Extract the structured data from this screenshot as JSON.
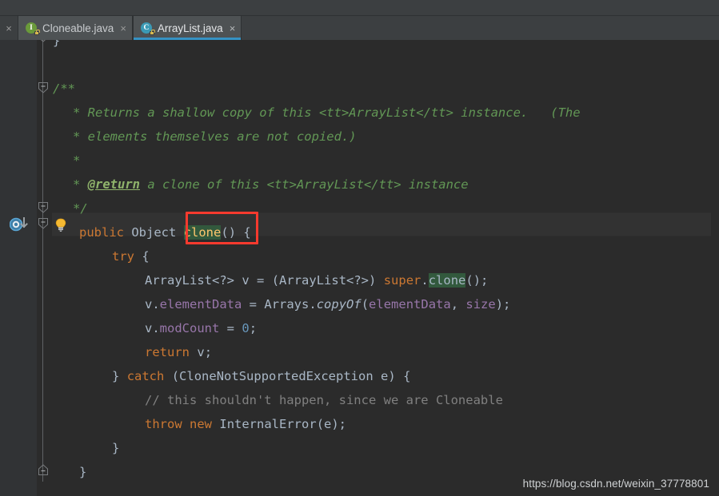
{
  "window": {
    "theme_background": "#2b2b2b",
    "chrome_background": "#3c3f41",
    "accent": "#3592c4"
  },
  "tabbar": {
    "close_all_glyph": "×",
    "tabs": [
      {
        "label": "Cloneable.java",
        "icon": "java-interface-icon",
        "icon_letter": "I",
        "active": false,
        "close_glyph": "×"
      },
      {
        "label": "ArrayList.java",
        "icon": "java-class-icon",
        "icon_letter": "C",
        "active": true,
        "close_glyph": "×"
      }
    ]
  },
  "gutter": {
    "implements_marker": "implementing-method-icon",
    "intention_bulb": "lightbulb-icon",
    "fold_markers": [
      "fold-collapse-icon",
      "fold-collapse-icon",
      "fold-collapse-icon",
      "fold-collapse-icon",
      "fold-collapse-icon"
    ]
  },
  "annotation": {
    "red_box_label": "red-highlight-rectangle",
    "color": "#f83a2e"
  },
  "watermark": {
    "text": "https://blog.csdn.net/weixin_37778801"
  },
  "editor": {
    "language": "Java",
    "current_line_text": "public Object clone() {",
    "caret_token": "clone",
    "code_lines": [
      {
        "n": 0,
        "text": "    }"
      },
      {
        "n": 1,
        "text": ""
      },
      {
        "n": 2,
        "text": "    /**"
      },
      {
        "n": 3,
        "text": "     * Returns a shallow copy of this <tt>ArrayList</tt> instance.   (The"
      },
      {
        "n": 4,
        "text": "     * elements themselves are not copied.)"
      },
      {
        "n": 5,
        "text": "     *"
      },
      {
        "n": 6,
        "text": "     * @return a clone of this <tt>ArrayList</tt> instance"
      },
      {
        "n": 7,
        "text": "     */"
      },
      {
        "n": 8,
        "text": "    public Object clone() {"
      },
      {
        "n": 9,
        "text": "        try {"
      },
      {
        "n": 10,
        "text": "            ArrayList<?> v = (ArrayList<?>) super.clone();"
      },
      {
        "n": 11,
        "text": "            v.elementData = Arrays.copyOf(elementData, size);"
      },
      {
        "n": 12,
        "text": "            v.modCount = 0;"
      },
      {
        "n": 13,
        "text": "            return v;"
      },
      {
        "n": 14,
        "text": "        } catch (CloneNotSupportedException e) {"
      },
      {
        "n": 15,
        "text": "            // this shouldn't happen, since we are Cloneable"
      },
      {
        "n": 16,
        "text": "            throw new InternalError(e);"
      },
      {
        "n": 17,
        "text": "        }"
      },
      {
        "n": 18,
        "text": "    }"
      }
    ],
    "tokens": {
      "javadoc_open": "/**",
      "javadoc_line1": "* Returns a shallow copy of this <tt>ArrayList</tt> instance.   (The",
      "javadoc_line2": "* elements themselves are not copied.)",
      "javadoc_line3": "*",
      "javadoc_return_star": "* ",
      "javadoc_return_tag": "@return",
      "javadoc_return_rest": " a clone of this <tt>ArrayList</tt> instance",
      "javadoc_close": "*/",
      "kw_public": "public",
      "type_object": "Object",
      "method_clone": "clone",
      "parens_empty": "()",
      "brace_open": "{",
      "kw_try": "try",
      "type_arraylist_decl": "ArrayList<?>",
      "var_v": "v",
      "eq": "=",
      "cast_arraylist": "(ArrayList<?>)",
      "kw_super": "super",
      "dot": ".",
      "call_clone": "clone",
      "call_parens_semi": "();",
      "v_dot": "v.",
      "fld_elementData": "elementData",
      "type_arrays": "Arrays",
      "static_copyOf": "copyOf",
      "args_open": "(",
      "arg_elementData": "elementData",
      "arg_comma": ", ",
      "arg_size": "size",
      "args_close_semi": ");",
      "fld_modCount": "modCount",
      "num_zero": "0",
      "semi": ";",
      "kw_return": "return",
      "brace_close": "}",
      "kw_catch": "catch",
      "exc_open": "(",
      "type_exception": "CloneNotSupportedException",
      "exc_var": "e",
      "exc_close": ")",
      "line_comment": "// this shouldn't happen, since we are Cloneable",
      "kw_throw": "throw",
      "kw_new": "new",
      "type_internalerror": "InternalError",
      "ie_args": "(e);"
    }
  }
}
